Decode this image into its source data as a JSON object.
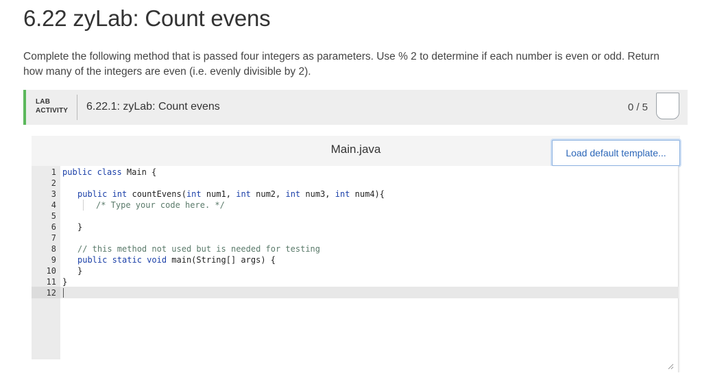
{
  "page": {
    "title": "6.22 zyLab: Count evens",
    "description": "Complete the following method that is passed four integers as parameters. Use % 2 to determine if each number is even or odd. Return how many of the integers are even (i.e. evenly divisible by 2)."
  },
  "lab": {
    "badge_line1": "LAB",
    "badge_line2": "ACTIVITY",
    "title": "6.22.1: zyLab: Count evens",
    "score": "0 / 5",
    "accent_color": "#5cb85c"
  },
  "editor": {
    "file_name": "Main.java",
    "load_template_label": "Load default template...",
    "line_numbers": [
      "1",
      "2",
      "3",
      "4",
      "5",
      "6",
      "7",
      "8",
      "9",
      "10",
      "11",
      "12"
    ],
    "lines": {
      "l1_kw": "public class",
      "l1_rest": " Main {",
      "l3_kw1": "public int",
      "l3_a": " countEvens(",
      "l3_kw2": "int",
      "l3_b": " num1, ",
      "l3_kw3": "int",
      "l3_c": " num2, ",
      "l3_kw4": "int",
      "l3_d": " num3, ",
      "l3_kw5": "int",
      "l3_e": " num4){",
      "l4": "/* Type your code here. */",
      "l6": "}",
      "l8": "// this method not used but is needed for testing",
      "l9_kw": "public static void",
      "l9_rest": " main(String[] args) {",
      "l10": "}",
      "l11": "}"
    }
  }
}
